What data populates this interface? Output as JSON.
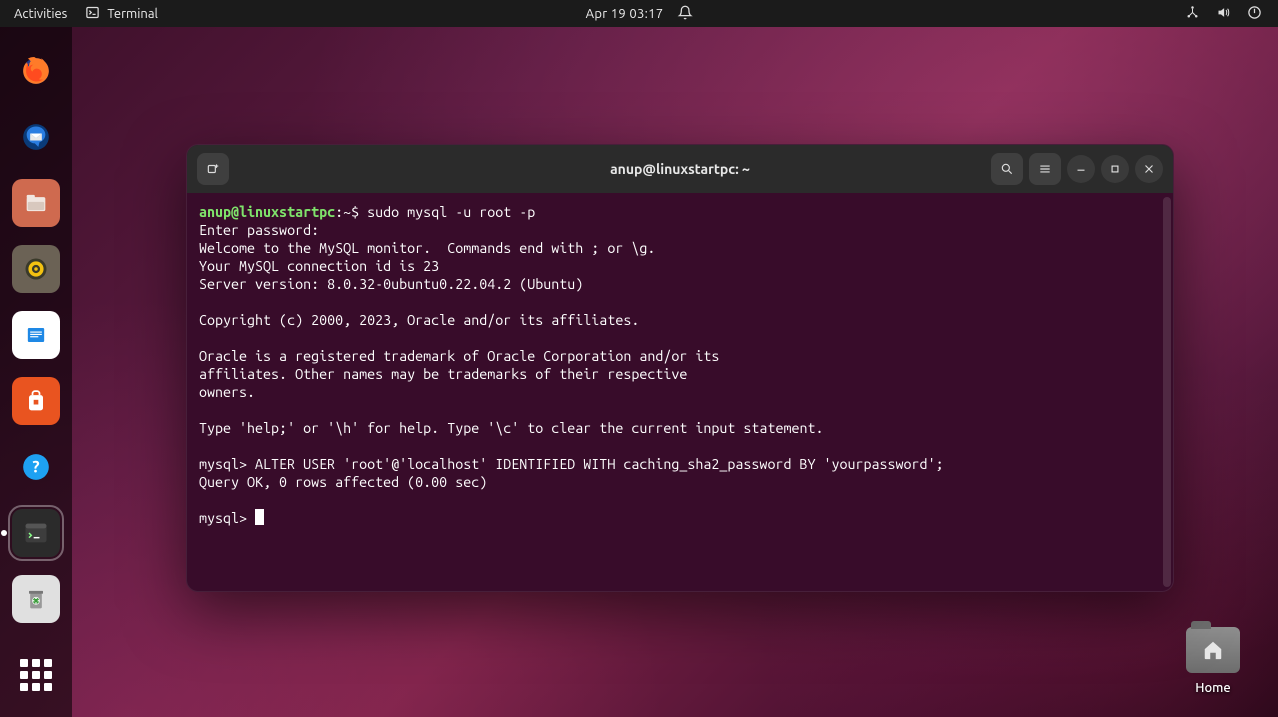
{
  "panel": {
    "activities": "Activities",
    "app_name": "Terminal",
    "clock": "Apr 19  03:17"
  },
  "desktop": {
    "home_label": "Home"
  },
  "terminal": {
    "title": "anup@linuxstartpc: ~",
    "prompt_userhost": "anup@linuxstartpc",
    "prompt_path": ":~$ ",
    "prompt_command": "sudo mysql -u root -p",
    "lines": {
      "l1": "Enter password:",
      "l2": "Welcome to the MySQL monitor.  Commands end with ; or \\g.",
      "l3": "Your MySQL connection id is 23",
      "l4": "Server version: 8.0.32-0ubuntu0.22.04.2 (Ubuntu)",
      "l5": "",
      "l6": "Copyright (c) 2000, 2023, Oracle and/or its affiliates.",
      "l7": "",
      "l8": "Oracle is a registered trademark of Oracle Corporation and/or its",
      "l9": "affiliates. Other names may be trademarks of their respective",
      "l10": "owners.",
      "l11": "",
      "l12": "Type 'help;' or '\\h' for help. Type '\\c' to clear the current input statement.",
      "l13": "",
      "l14": "mysql> ALTER USER 'root'@'localhost' IDENTIFIED WITH caching_sha2_password BY 'yourpassword';",
      "l15": "Query OK, 0 rows affected (0.00 sec)",
      "l16": "",
      "l17": "mysql> "
    }
  }
}
